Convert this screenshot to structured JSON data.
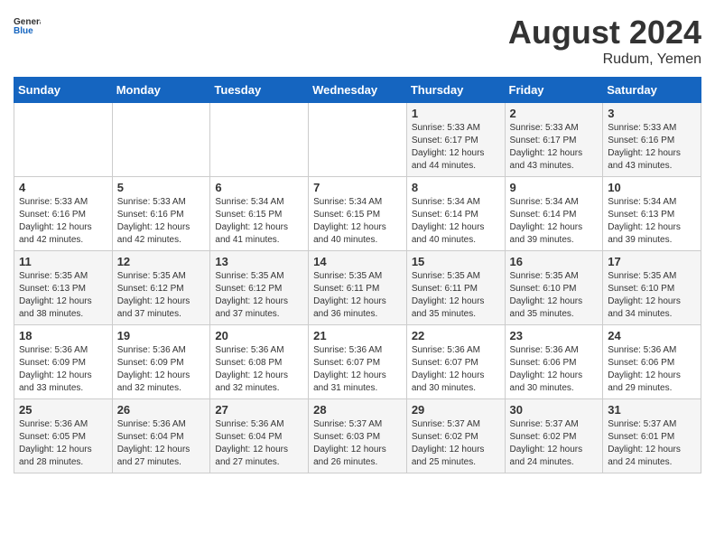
{
  "header": {
    "logo_general": "General",
    "logo_blue": "Blue",
    "month_year": "August 2024",
    "location": "Rudum, Yemen"
  },
  "days_of_week": [
    "Sunday",
    "Monday",
    "Tuesday",
    "Wednesday",
    "Thursday",
    "Friday",
    "Saturday"
  ],
  "weeks": [
    [
      {
        "day": "",
        "info": ""
      },
      {
        "day": "",
        "info": ""
      },
      {
        "day": "",
        "info": ""
      },
      {
        "day": "",
        "info": ""
      },
      {
        "day": "1",
        "info": "Sunrise: 5:33 AM\nSunset: 6:17 PM\nDaylight: 12 hours\nand 44 minutes."
      },
      {
        "day": "2",
        "info": "Sunrise: 5:33 AM\nSunset: 6:17 PM\nDaylight: 12 hours\nand 43 minutes."
      },
      {
        "day": "3",
        "info": "Sunrise: 5:33 AM\nSunset: 6:16 PM\nDaylight: 12 hours\nand 43 minutes."
      }
    ],
    [
      {
        "day": "4",
        "info": "Sunrise: 5:33 AM\nSunset: 6:16 PM\nDaylight: 12 hours\nand 42 minutes."
      },
      {
        "day": "5",
        "info": "Sunrise: 5:33 AM\nSunset: 6:16 PM\nDaylight: 12 hours\nand 42 minutes."
      },
      {
        "day": "6",
        "info": "Sunrise: 5:34 AM\nSunset: 6:15 PM\nDaylight: 12 hours\nand 41 minutes."
      },
      {
        "day": "7",
        "info": "Sunrise: 5:34 AM\nSunset: 6:15 PM\nDaylight: 12 hours\nand 40 minutes."
      },
      {
        "day": "8",
        "info": "Sunrise: 5:34 AM\nSunset: 6:14 PM\nDaylight: 12 hours\nand 40 minutes."
      },
      {
        "day": "9",
        "info": "Sunrise: 5:34 AM\nSunset: 6:14 PM\nDaylight: 12 hours\nand 39 minutes."
      },
      {
        "day": "10",
        "info": "Sunrise: 5:34 AM\nSunset: 6:13 PM\nDaylight: 12 hours\nand 39 minutes."
      }
    ],
    [
      {
        "day": "11",
        "info": "Sunrise: 5:35 AM\nSunset: 6:13 PM\nDaylight: 12 hours\nand 38 minutes."
      },
      {
        "day": "12",
        "info": "Sunrise: 5:35 AM\nSunset: 6:12 PM\nDaylight: 12 hours\nand 37 minutes."
      },
      {
        "day": "13",
        "info": "Sunrise: 5:35 AM\nSunset: 6:12 PM\nDaylight: 12 hours\nand 37 minutes."
      },
      {
        "day": "14",
        "info": "Sunrise: 5:35 AM\nSunset: 6:11 PM\nDaylight: 12 hours\nand 36 minutes."
      },
      {
        "day": "15",
        "info": "Sunrise: 5:35 AM\nSunset: 6:11 PM\nDaylight: 12 hours\nand 35 minutes."
      },
      {
        "day": "16",
        "info": "Sunrise: 5:35 AM\nSunset: 6:10 PM\nDaylight: 12 hours\nand 35 minutes."
      },
      {
        "day": "17",
        "info": "Sunrise: 5:35 AM\nSunset: 6:10 PM\nDaylight: 12 hours\nand 34 minutes."
      }
    ],
    [
      {
        "day": "18",
        "info": "Sunrise: 5:36 AM\nSunset: 6:09 PM\nDaylight: 12 hours\nand 33 minutes."
      },
      {
        "day": "19",
        "info": "Sunrise: 5:36 AM\nSunset: 6:09 PM\nDaylight: 12 hours\nand 32 minutes."
      },
      {
        "day": "20",
        "info": "Sunrise: 5:36 AM\nSunset: 6:08 PM\nDaylight: 12 hours\nand 32 minutes."
      },
      {
        "day": "21",
        "info": "Sunrise: 5:36 AM\nSunset: 6:07 PM\nDaylight: 12 hours\nand 31 minutes."
      },
      {
        "day": "22",
        "info": "Sunrise: 5:36 AM\nSunset: 6:07 PM\nDaylight: 12 hours\nand 30 minutes."
      },
      {
        "day": "23",
        "info": "Sunrise: 5:36 AM\nSunset: 6:06 PM\nDaylight: 12 hours\nand 30 minutes."
      },
      {
        "day": "24",
        "info": "Sunrise: 5:36 AM\nSunset: 6:06 PM\nDaylight: 12 hours\nand 29 minutes."
      }
    ],
    [
      {
        "day": "25",
        "info": "Sunrise: 5:36 AM\nSunset: 6:05 PM\nDaylight: 12 hours\nand 28 minutes."
      },
      {
        "day": "26",
        "info": "Sunrise: 5:36 AM\nSunset: 6:04 PM\nDaylight: 12 hours\nand 27 minutes."
      },
      {
        "day": "27",
        "info": "Sunrise: 5:36 AM\nSunset: 6:04 PM\nDaylight: 12 hours\nand 27 minutes."
      },
      {
        "day": "28",
        "info": "Sunrise: 5:37 AM\nSunset: 6:03 PM\nDaylight: 12 hours\nand 26 minutes."
      },
      {
        "day": "29",
        "info": "Sunrise: 5:37 AM\nSunset: 6:02 PM\nDaylight: 12 hours\nand 25 minutes."
      },
      {
        "day": "30",
        "info": "Sunrise: 5:37 AM\nSunset: 6:02 PM\nDaylight: 12 hours\nand 24 minutes."
      },
      {
        "day": "31",
        "info": "Sunrise: 5:37 AM\nSunset: 6:01 PM\nDaylight: 12 hours\nand 24 minutes."
      }
    ]
  ]
}
